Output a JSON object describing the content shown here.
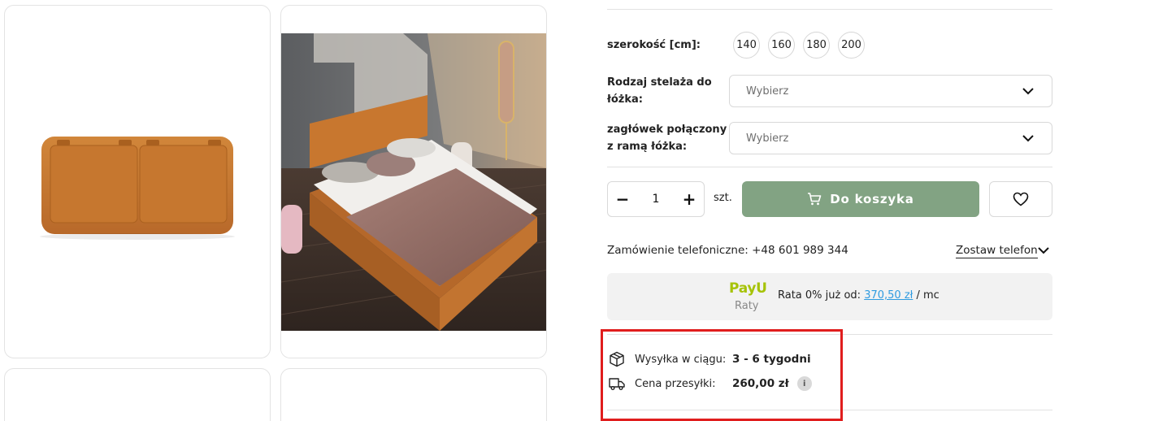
{
  "gallery": {
    "image1_alt": "Zagłówek tapicerowany",
    "image2_alt": "Łóżko tapicerowane w sypialni"
  },
  "options": {
    "width_label": "szerokość [cm]:",
    "widths": [
      "140",
      "160",
      "180",
      "200"
    ],
    "frame_label_line1": "Rodzaj stelaża do",
    "frame_label_line2": "łóżka:",
    "frame_placeholder": "Wybierz",
    "headboard_label_line1": "zagłówek połączony",
    "headboard_label_line2": "z ramą łóżka:",
    "headboard_placeholder": "Wybierz"
  },
  "purchase": {
    "quantity": "1",
    "minus": "−",
    "plus": "+",
    "unit": "szt.",
    "cart_label": "Do koszyka"
  },
  "phone_order": {
    "text": "Zamówienie telefoniczne: +48 601 989 344",
    "leave_phone": "Zostaw telefon"
  },
  "payu": {
    "logo": "PayU",
    "raty": "Raty",
    "text_prefix": "Rata 0% już od: ",
    "amount": "370,50 zł",
    "text_suffix": " / mc"
  },
  "shipping": {
    "time_label": "Wysyłka w ciągu:",
    "time_value": "3 - 6 tygodni",
    "price_label": "Cena przesyłki:",
    "price_value": "260,00 zł",
    "info": "i"
  },
  "colors": {
    "accent": "#82a383",
    "payu_green": "#a6c307",
    "link": "#2f9be0",
    "highlight": "#e01d1d",
    "upholstery": "#c9782f"
  }
}
